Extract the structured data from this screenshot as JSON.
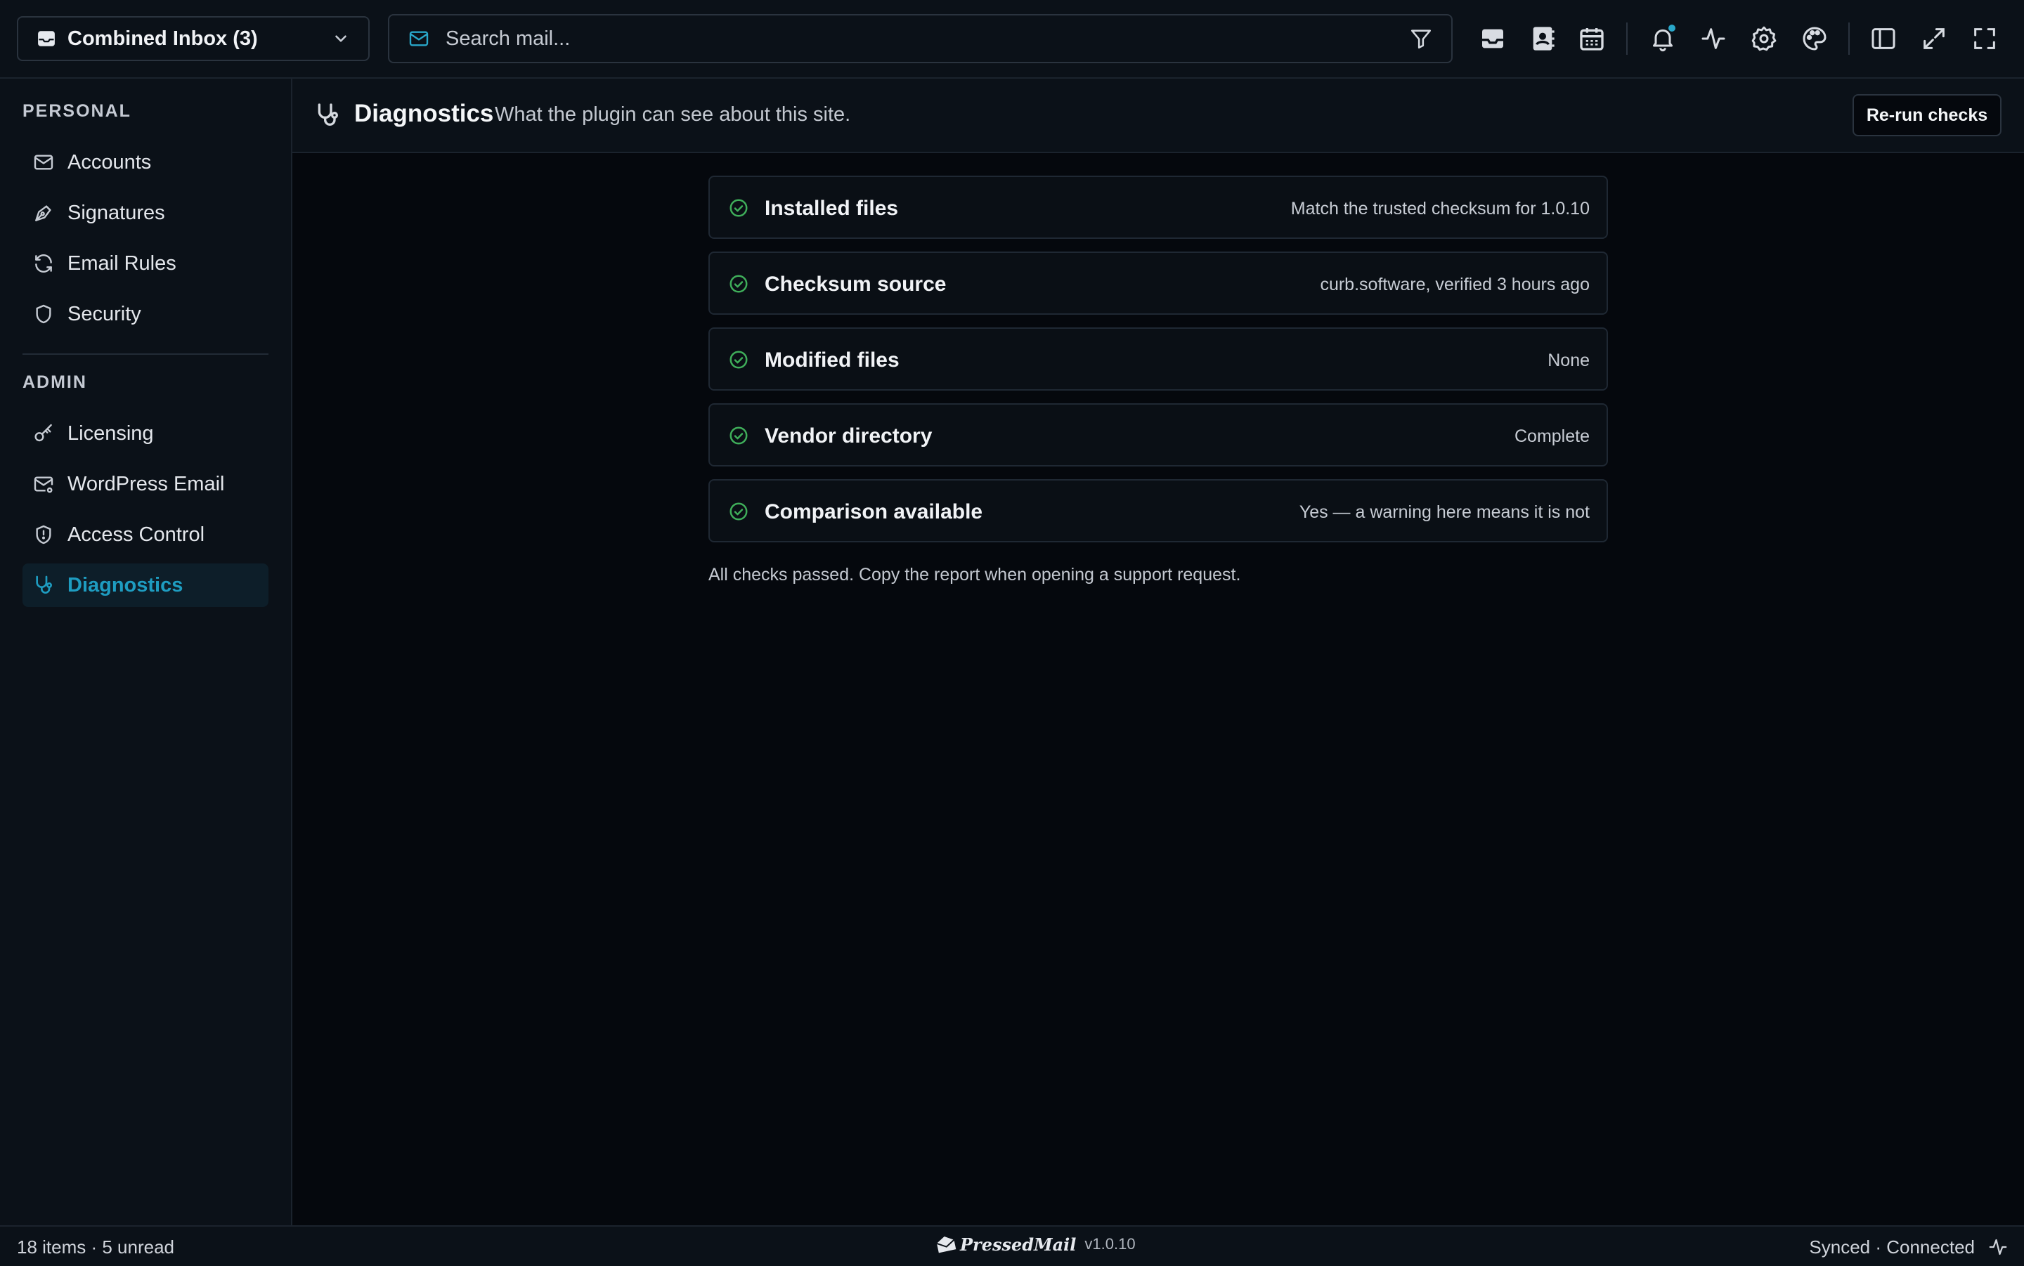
{
  "topbar": {
    "inbox_label": "Combined Inbox (3)",
    "search_placeholder": "Search mail...",
    "icons": [
      "inbox-icon",
      "contacts-icon",
      "calendar-icon",
      "bell-icon",
      "activity-icon",
      "gear-icon",
      "palette-icon",
      "sidebar-toggle-icon",
      "expand-icon",
      "fullscreen-icon"
    ]
  },
  "sidebar": {
    "personal_heading": "PERSONAL",
    "personal_items": [
      {
        "label": "Accounts",
        "icon": "mail-icon"
      },
      {
        "label": "Signatures",
        "icon": "pen-nib-icon"
      },
      {
        "label": "Email Rules",
        "icon": "refresh-icon"
      },
      {
        "label": "Security",
        "icon": "shield-icon"
      }
    ],
    "admin_heading": "ADMIN",
    "admin_items": [
      {
        "label": "Licensing",
        "icon": "key-icon"
      },
      {
        "label": "WordPress Email",
        "icon": "mail-settings-icon"
      },
      {
        "label": "Access Control",
        "icon": "shield-alert-icon"
      },
      {
        "label": "Diagnostics",
        "icon": "stethoscope-icon",
        "active": true
      }
    ]
  },
  "page": {
    "title": "Diagnostics",
    "subtitle": "What the plugin can see about this site.",
    "rerun_label": "Re-run checks"
  },
  "checks": [
    {
      "name": "Installed files",
      "value": "Match the trusted checksum for 1.0.10",
      "status": "pass"
    },
    {
      "name": "Checksum source",
      "value": "curb.software, verified 3 hours ago",
      "status": "pass"
    },
    {
      "name": "Modified files",
      "value": "None",
      "status": "pass"
    },
    {
      "name": "Vendor directory",
      "value": "Complete",
      "status": "pass"
    },
    {
      "name": "Comparison available",
      "value": "Yes — a warning here means it is not",
      "status": "pass"
    }
  ],
  "summary": "All checks passed. Copy the report when opening a support request.",
  "statusbar": {
    "left": "18 items · 5 unread",
    "brand": "PressedMail",
    "version": "v1.0.10",
    "right": "Synced · Connected"
  },
  "colors": {
    "background": "#05080d",
    "panel": "#0b1118",
    "accent": "#1e9cc0",
    "pass_green": "#3fae5a"
  }
}
